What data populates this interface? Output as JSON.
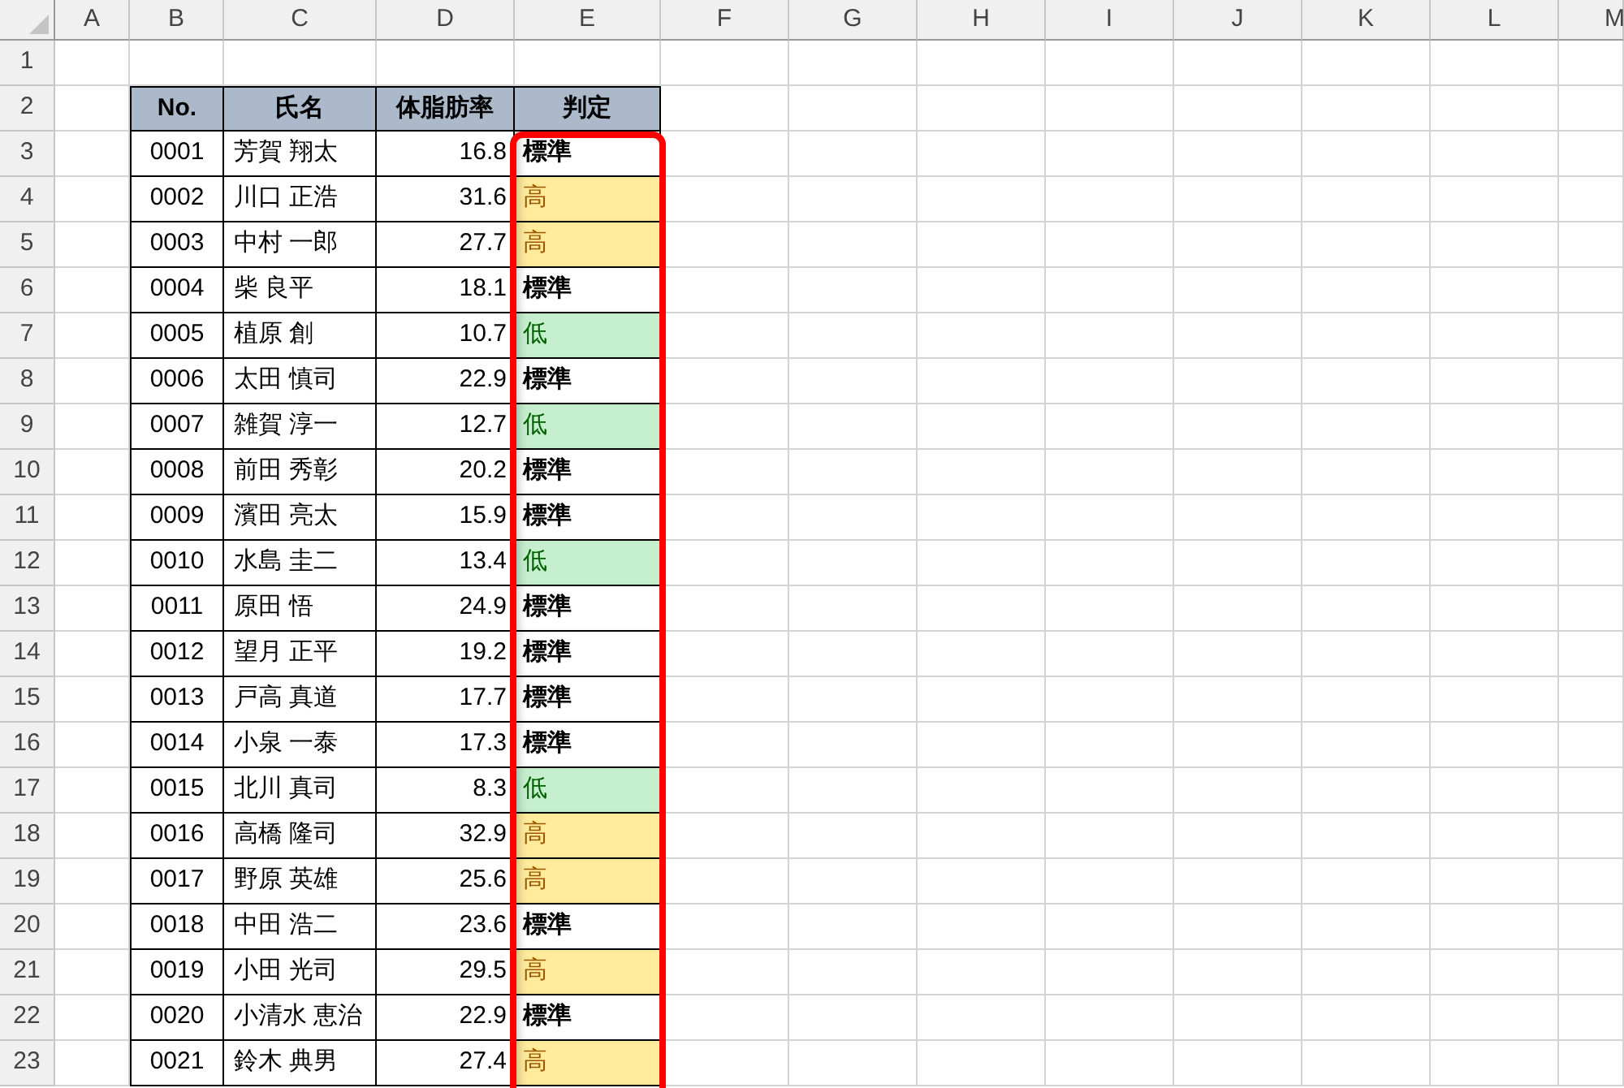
{
  "columns": [
    "A",
    "B",
    "C",
    "D",
    "E",
    "F",
    "G",
    "H",
    "I",
    "J",
    "K",
    "L",
    "M"
  ],
  "row_numbers": [
    "1",
    "2",
    "3",
    "4",
    "5",
    "6",
    "7",
    "8",
    "9",
    "10",
    "11",
    "12",
    "13",
    "14",
    "15",
    "16",
    "17",
    "18",
    "19",
    "20",
    "21",
    "22",
    "23"
  ],
  "table": {
    "headers": [
      "No.",
      "氏名",
      "体脂肪率",
      "判定"
    ],
    "rows": [
      {
        "no": "0001",
        "name": "芳賀 翔太",
        "rate": "16.8",
        "result": "標準",
        "kind": "standard"
      },
      {
        "no": "0002",
        "name": "川口 正浩",
        "rate": "31.6",
        "result": "高",
        "kind": "high"
      },
      {
        "no": "0003",
        "name": "中村 一郎",
        "rate": "27.7",
        "result": "高",
        "kind": "high"
      },
      {
        "no": "0004",
        "name": "柴 良平",
        "rate": "18.1",
        "result": "標準",
        "kind": "standard"
      },
      {
        "no": "0005",
        "name": "植原 創",
        "rate": "10.7",
        "result": "低",
        "kind": "low"
      },
      {
        "no": "0006",
        "name": "太田 慎司",
        "rate": "22.9",
        "result": "標準",
        "kind": "standard"
      },
      {
        "no": "0007",
        "name": "雑賀 淳一",
        "rate": "12.7",
        "result": "低",
        "kind": "low"
      },
      {
        "no": "0008",
        "name": "前田 秀彰",
        "rate": "20.2",
        "result": "標準",
        "kind": "standard"
      },
      {
        "no": "0009",
        "name": "濱田 亮太",
        "rate": "15.9",
        "result": "標準",
        "kind": "standard"
      },
      {
        "no": "0010",
        "name": "水島 圭二",
        "rate": "13.4",
        "result": "低",
        "kind": "low"
      },
      {
        "no": "0011",
        "name": "原田 悟",
        "rate": "24.9",
        "result": "標準",
        "kind": "standard"
      },
      {
        "no": "0012",
        "name": "望月 正平",
        "rate": "19.2",
        "result": "標準",
        "kind": "standard"
      },
      {
        "no": "0013",
        "name": "戸高 真道",
        "rate": "17.7",
        "result": "標準",
        "kind": "standard"
      },
      {
        "no": "0014",
        "name": "小泉 一泰",
        "rate": "17.3",
        "result": "標準",
        "kind": "standard"
      },
      {
        "no": "0015",
        "name": "北川 真司",
        "rate": "8.3",
        "result": "低",
        "kind": "low"
      },
      {
        "no": "0016",
        "name": "高橋 隆司",
        "rate": "32.9",
        "result": "高",
        "kind": "high"
      },
      {
        "no": "0017",
        "name": "野原 英雄",
        "rate": "25.6",
        "result": "高",
        "kind": "high"
      },
      {
        "no": "0018",
        "name": "中田 浩二",
        "rate": "23.6",
        "result": "標準",
        "kind": "standard"
      },
      {
        "no": "0019",
        "name": "小田 光司",
        "rate": "29.5",
        "result": "高",
        "kind": "high"
      },
      {
        "no": "0020",
        "name": "小清水 恵治",
        "rate": "22.9",
        "result": "標準",
        "kind": "standard"
      },
      {
        "no": "0021",
        "name": "鈴木 典男",
        "rate": "27.4",
        "result": "高",
        "kind": "high"
      }
    ]
  }
}
